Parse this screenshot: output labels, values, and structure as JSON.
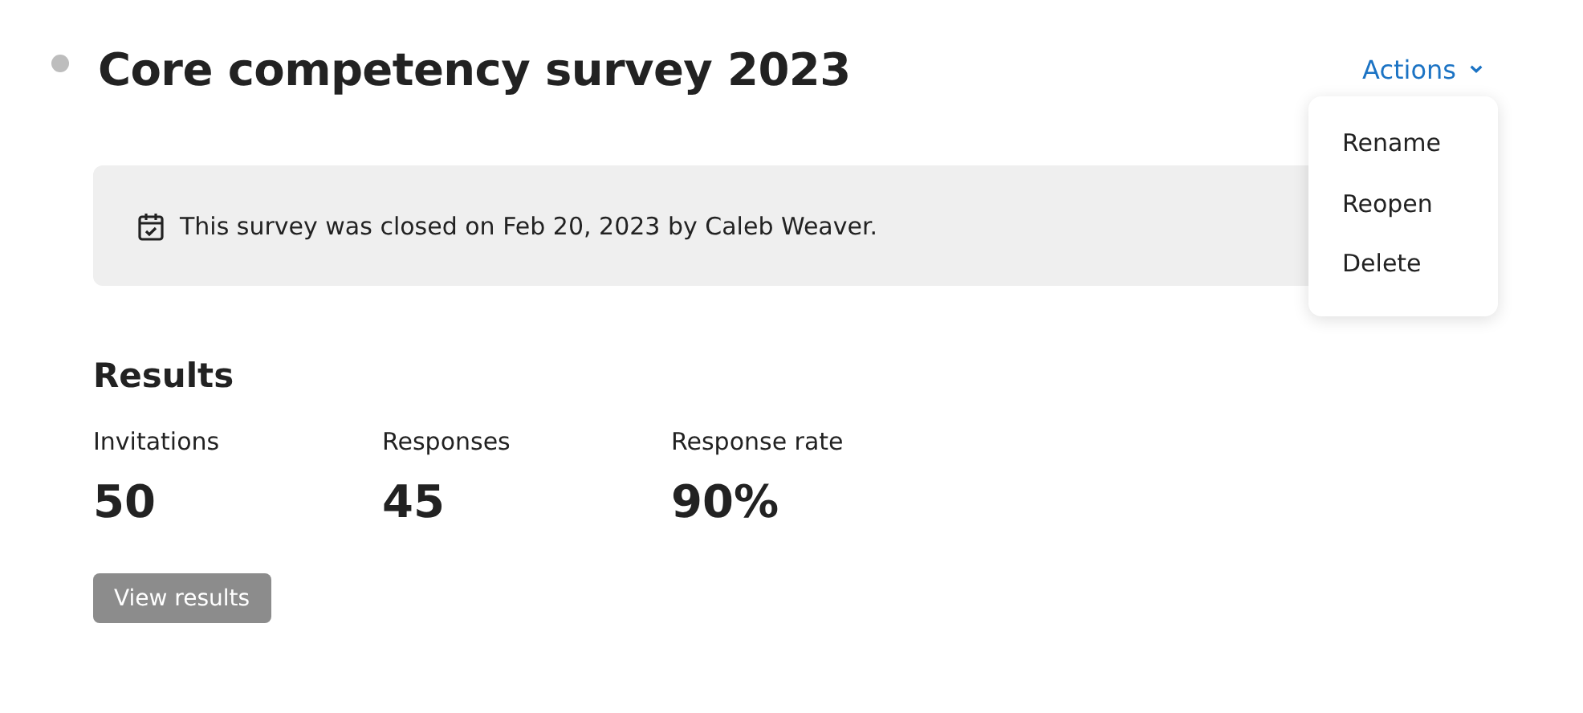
{
  "survey": {
    "title": "Core competency survey 2023",
    "closed": true
  },
  "actions": {
    "label": "Actions",
    "expanded": true,
    "menu": [
      {
        "label": "Rename"
      },
      {
        "label": "Reopen"
      },
      {
        "label": "Delete"
      }
    ]
  },
  "notice": {
    "text": "This survey was closed on Feb 20, 2023 by Caleb Weaver."
  },
  "results": {
    "heading": "Results",
    "stats": [
      {
        "label": "Invitations",
        "value": "50"
      },
      {
        "label": "Responses",
        "value": "45"
      },
      {
        "label": "Response rate",
        "value": "90%"
      }
    ],
    "button": {
      "label": "View results",
      "disabled": true
    }
  }
}
